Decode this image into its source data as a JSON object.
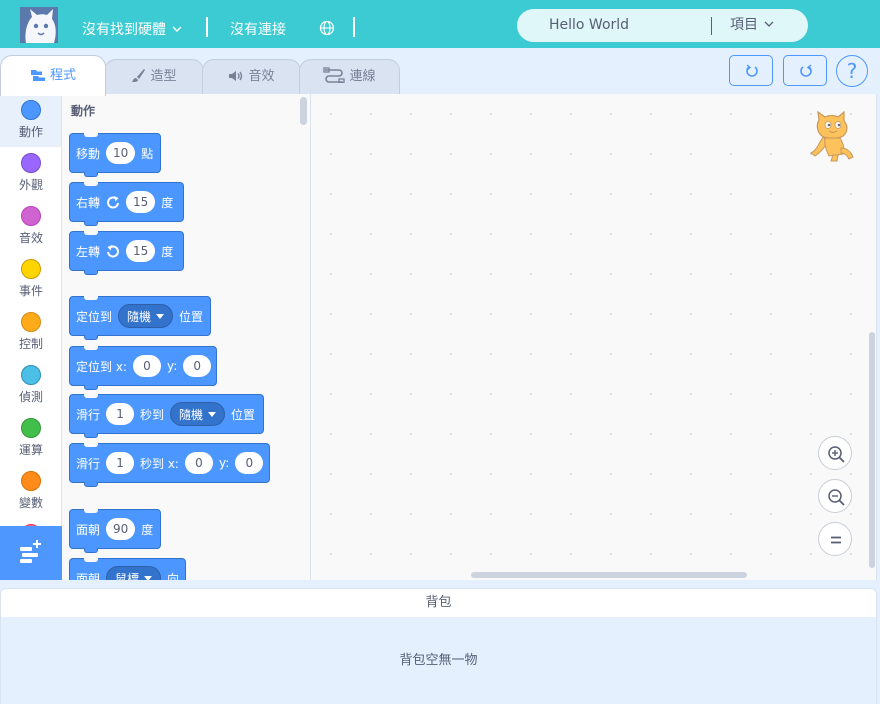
{
  "topbar": {
    "hardware_status": "沒有找到硬體",
    "connection_status": "沒有連接",
    "project_title": "Hello World",
    "project_menu": "項目",
    "logo_icon": "scratch-cat-logo",
    "globe_icon": "globe-icon"
  },
  "tabs": [
    {
      "label": "程式",
      "icon": "code-icon",
      "active": true
    },
    {
      "label": "造型",
      "icon": "brush-icon",
      "active": false
    },
    {
      "label": "音效",
      "icon": "speaker-icon",
      "active": false
    },
    {
      "label": "連線",
      "icon": "connection-icon",
      "active": false
    }
  ],
  "toolbar": {
    "undo_icon": "undo-icon",
    "redo_icon": "redo-icon",
    "help_label": "?"
  },
  "categories": [
    {
      "label": "動作",
      "color": "#4c97ff",
      "selected": true
    },
    {
      "label": "外觀",
      "color": "#9966ff",
      "selected": false
    },
    {
      "label": "音效",
      "color": "#cf63cf",
      "selected": false
    },
    {
      "label": "事件",
      "color": "#ffd500",
      "selected": false
    },
    {
      "label": "控制",
      "color": "#ffab19",
      "selected": false
    },
    {
      "label": "偵測",
      "color": "#4cbfe6",
      "selected": false
    },
    {
      "label": "運算",
      "color": "#40bf4a",
      "selected": false
    },
    {
      "label": "變數",
      "color": "#ff8c1a",
      "selected": false
    }
  ],
  "flyout": {
    "section_title": "動作",
    "blocks": {
      "move": {
        "text1": "移動",
        "value": "10",
        "text2": "點"
      },
      "turn_right": {
        "text1": "右轉",
        "value": "15",
        "text2": "度"
      },
      "turn_left": {
        "text1": "左轉",
        "value": "15",
        "text2": "度"
      },
      "goto": {
        "text1": "定位到",
        "dropdown": "隨機",
        "text2": "位置"
      },
      "goto_xy": {
        "text1": "定位到 x:",
        "x": "0",
        "ylabel": "y:",
        "y": "0"
      },
      "glide_to": {
        "text1": "滑行",
        "secs": "1",
        "text2": "秒到",
        "dropdown": "隨機",
        "text3": "位置"
      },
      "glide_xy": {
        "text1": "滑行",
        "secs": "1",
        "text2": "秒到 x:",
        "x": "0",
        "ylabel": "y:",
        "y": "0"
      },
      "point_dir": {
        "text1": "面朝",
        "value": "90",
        "text2": "度"
      },
      "point_towards": {
        "text1": "面朝",
        "dropdown": "鼠標",
        "text2": "向"
      }
    }
  },
  "workspace": {
    "zoom_in_icon": "zoom-in-icon",
    "zoom_out_icon": "zoom-out-icon",
    "zoom_reset_icon": "zoom-reset-icon"
  },
  "backpack": {
    "header": "背包",
    "empty_text": "背包空無一物"
  },
  "colors": {
    "accent": "#4d97ff",
    "topbar": "#3ccbd2",
    "motion_block": "#4c97ff"
  }
}
